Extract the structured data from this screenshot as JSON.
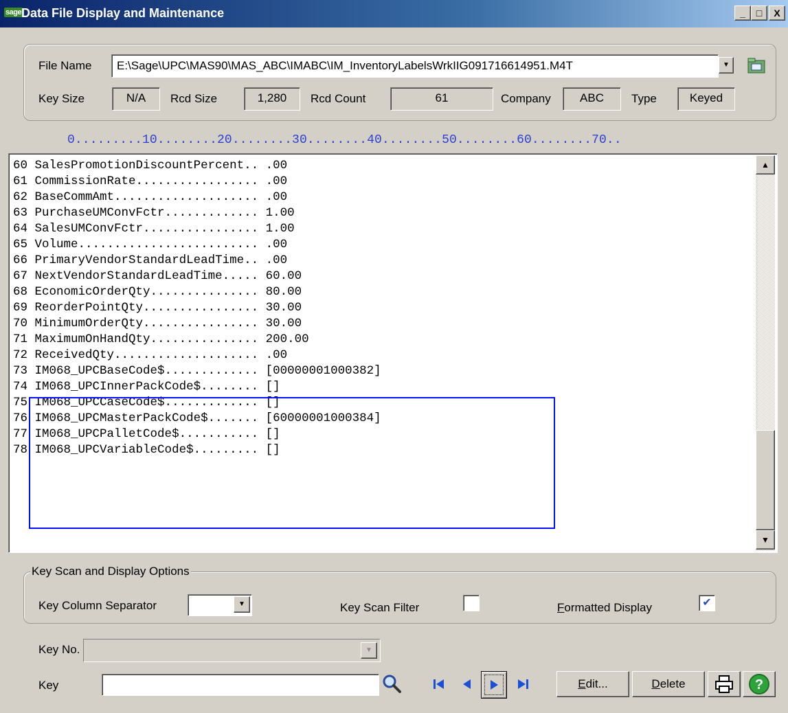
{
  "window": {
    "logo": "sage",
    "title": "Data File Display and Maintenance",
    "controls": [
      "_",
      "□",
      "X"
    ]
  },
  "file_info": {
    "file_name_label": "File Name",
    "file_name_value": "E:\\Sage\\UPC\\MAS90\\MAS_ABC\\IMABC\\IM_InventoryLabelsWrkIIG091716614951.M4T",
    "key_size_label": "Key Size",
    "key_size_value": "N/A",
    "rcd_size_label": "Rcd Size",
    "rcd_size_value": "1,280",
    "rcd_count_label": "Rcd Count",
    "rcd_count_value": "61",
    "company_label": "Company",
    "company_value": "ABC",
    "type_label": "Type",
    "type_value": "Keyed"
  },
  "ruler": "0.........10........20........30........40........50........60........70..",
  "records": [
    {
      "num": "60",
      "field": "SalesPromotionDiscountPercent..",
      "value": ".00"
    },
    {
      "num": "61",
      "field": "CommissionRate.................",
      "value": ".00"
    },
    {
      "num": "62",
      "field": "BaseCommAmt....................",
      "value": ".00"
    },
    {
      "num": "63",
      "field": "PurchaseUMConvFctr.............",
      "value": "1.00"
    },
    {
      "num": "64",
      "field": "SalesUMConvFctr................",
      "value": "1.00"
    },
    {
      "num": "65",
      "field": "Volume.........................",
      "value": ".00"
    },
    {
      "num": "66",
      "field": "PrimaryVendorStandardLeadTime..",
      "value": ".00"
    },
    {
      "num": "67",
      "field": "NextVendorStandardLeadTime.....",
      "value": "60.00"
    },
    {
      "num": "68",
      "field": "EconomicOrderQty...............",
      "value": "80.00"
    },
    {
      "num": "69",
      "field": "ReorderPointQty................",
      "value": "30.00"
    },
    {
      "num": "70",
      "field": "MinimumOrderQty................",
      "value": "30.00"
    },
    {
      "num": "71",
      "field": "MaximumOnHandQty...............",
      "value": "200.00"
    },
    {
      "num": "72",
      "field": "ReceivedQty....................",
      "value": ".00"
    },
    {
      "num": "73",
      "field": "IM068_UPCBaseCode$.............",
      "value": "[00000001000382]"
    },
    {
      "num": "74",
      "field": "IM068_UPCInnerPackCode$........",
      "value": "[]"
    },
    {
      "num": "75",
      "field": "IM068_UPCCaseCode$.............",
      "value": "[]"
    },
    {
      "num": "76",
      "field": "IM068_UPCMasterPackCode$.......",
      "value": "[60000001000384]"
    },
    {
      "num": "77",
      "field": "IM068_UPCPalletCode$...........",
      "value": "[]"
    },
    {
      "num": "78",
      "field": "IM068_UPCVariableCode$.........",
      "value": "[]"
    }
  ],
  "options": {
    "group_title": "Key Scan and Display Options",
    "key_column_separator_label": "Key Column Separator",
    "key_column_separator_value": "",
    "key_scan_filter_label": "Key Scan Filter",
    "key_scan_filter_checked": false,
    "formatted_display_label_first": "F",
    "formatted_display_label_rest": "ormatted Display",
    "formatted_display_checked": true
  },
  "footer": {
    "key_no_label": "Key No.",
    "key_no_value": "",
    "key_label": "Key",
    "key_value": "",
    "edit_label_first": "E",
    "edit_label_rest": "dit...",
    "delete_label_first": "D",
    "delete_label_rest": "elete"
  },
  "colors": {
    "ruler": "#2b3fd0",
    "highlight_box": "#0010ff",
    "title_bar": "#0a246a"
  },
  "icons": [
    "browse-folder-icon",
    "search-magnifier-icon",
    "first-record-icon",
    "previous-record-icon",
    "next-record-icon",
    "last-record-icon",
    "printer-icon",
    "help-icon",
    "checkmark-icon"
  ]
}
